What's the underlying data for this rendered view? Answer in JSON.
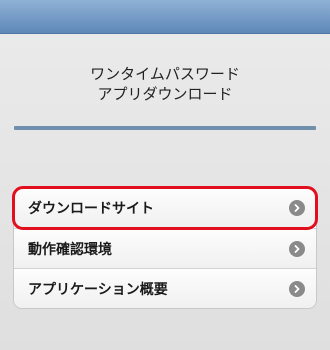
{
  "header": {
    "title_line1": "ワンタイムパスワード",
    "title_line2": "アプリダウンロード"
  },
  "menu": {
    "items": [
      {
        "label": "ダウンロードサイト",
        "icon": "chevron-right-icon",
        "selected": true
      },
      {
        "label": "動作確認環境",
        "icon": "chevron-right-icon",
        "selected": false
      },
      {
        "label": "アプリケーション概要",
        "icon": "chevron-right-icon",
        "selected": false
      }
    ]
  },
  "colors": {
    "top_bar": "#6f93c0",
    "divider": "#6f8fac",
    "highlight": "#e2101e",
    "chevron": "#8a8a8a"
  }
}
